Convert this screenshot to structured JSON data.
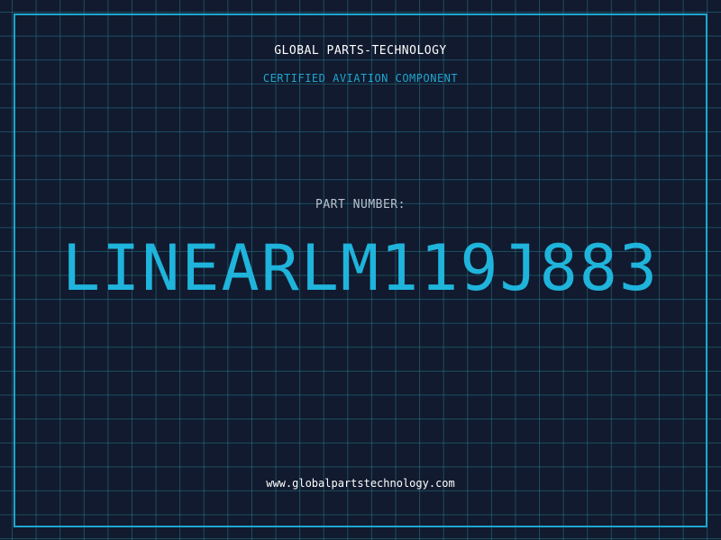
{
  "header": {
    "company": "GLOBAL PARTS-TECHNOLOGY",
    "subtitle": "CERTIFIED AVIATION COMPONENT"
  },
  "part": {
    "label": "PART NUMBER:",
    "number": "LINEARLM119J883"
  },
  "footer": {
    "website": "www.globalpartstechnology.com"
  },
  "colors": {
    "background": "#111a2e",
    "grid": "#26788c",
    "accent": "#1fa6cf",
    "part_number": "#1fb4dc",
    "label": "#b9c3cf",
    "text": "#ffffff"
  }
}
